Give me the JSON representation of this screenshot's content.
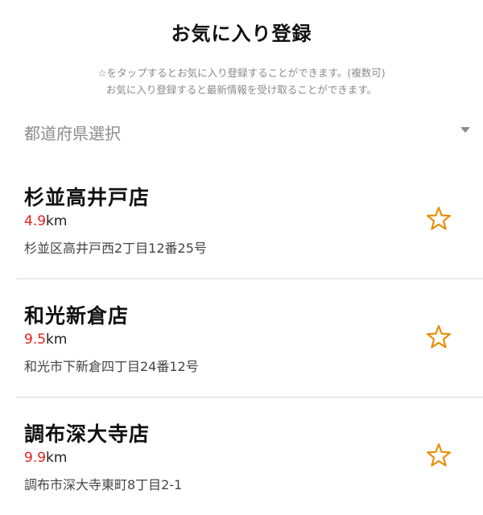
{
  "header": {
    "title": "お気に入り登録"
  },
  "description": {
    "line1": "☆をタップするとお気に入り登録することができます。(複数可)",
    "line2": "お気に入り登録すると最新情報を受け取ることができます。"
  },
  "prefecture_select": {
    "label": "都道府県選択"
  },
  "stores": [
    {
      "name": "杉並高井戸店",
      "distance_value": "4.9",
      "distance_unit": "km",
      "address": "杉並区高井戸西2丁目12番25号",
      "favorite": false
    },
    {
      "name": "和光新倉店",
      "distance_value": "9.5",
      "distance_unit": "km",
      "address": "和光市下新倉四丁目24番12号",
      "favorite": false
    },
    {
      "name": "調布深大寺店",
      "distance_value": "9.9",
      "distance_unit": "km",
      "address": "調布市深大寺東町8丁目2-1",
      "favorite": false
    }
  ],
  "colors": {
    "accent_star": "#e8900c",
    "distance_number": "#e8201a"
  },
  "icons": {
    "favorite": "star-outline-icon",
    "dropdown": "chevron-down-icon"
  }
}
